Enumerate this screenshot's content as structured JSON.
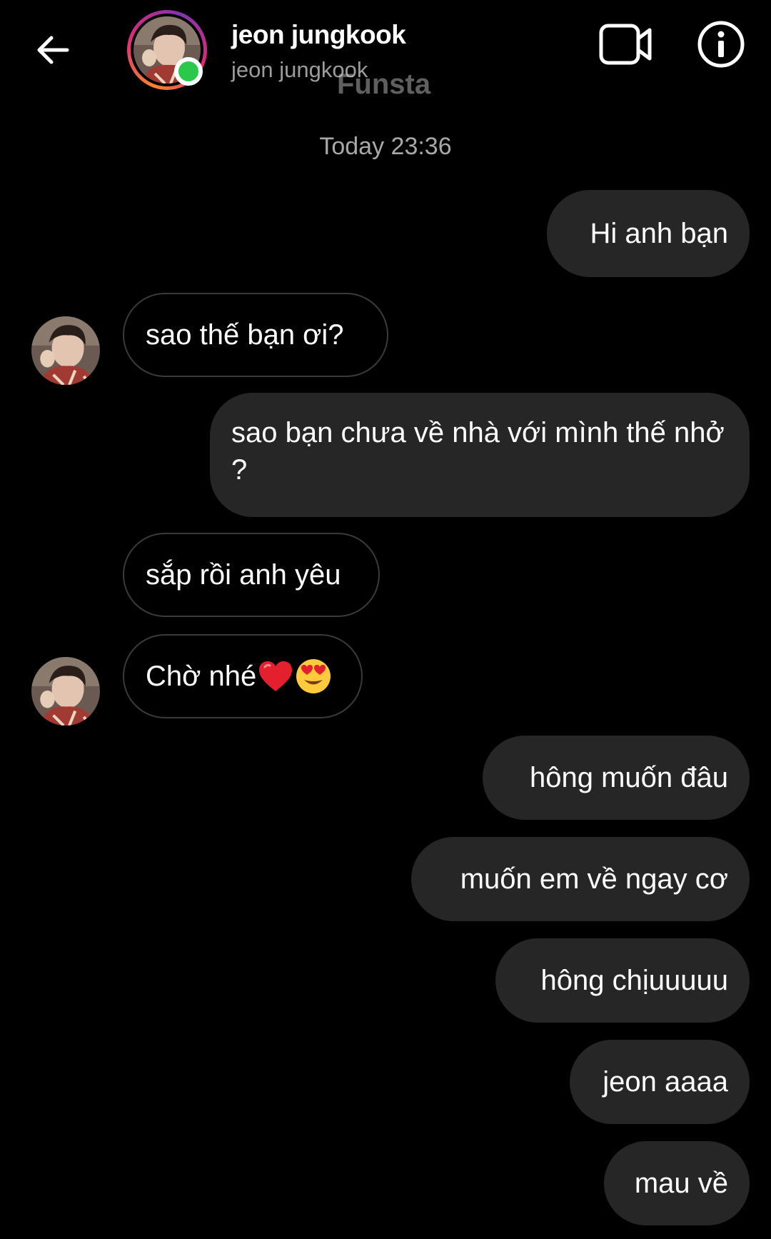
{
  "header": {
    "name": "jeon jungkook",
    "subtitle": "jeon jungkook",
    "watermark": "Funsta"
  },
  "timestamp": "Today 23:36",
  "messages": [
    {
      "from": "me",
      "text": "Hi anh bạn"
    },
    {
      "from": "them",
      "text": "sao thế bạn ơi?"
    },
    {
      "from": "me",
      "text": "sao bạn chưa về nhà với mình thế nhở ?"
    },
    {
      "from": "them",
      "text": "sắp rồi anh yêu"
    },
    {
      "from": "them",
      "text": "Chờ nhé",
      "emojis": [
        "red-heart",
        "heart-eyes-face"
      ]
    },
    {
      "from": "me",
      "text": "hông muốn đâu"
    },
    {
      "from": "me",
      "text": "muốn em về ngay cơ"
    },
    {
      "from": "me",
      "text": "hông chịuuuuu"
    },
    {
      "from": "me",
      "text": "jeon aaaa"
    },
    {
      "from": "me",
      "text": "mau về"
    }
  ],
  "icons": {
    "back": "arrow-left-icon",
    "video": "video-camera-icon",
    "info": "info-icon"
  },
  "colors": {
    "background": "#000000",
    "sent_bubble": "#262626",
    "received_border": "#3a3a3a",
    "online": "#2ac94b",
    "muted_text": "#9c9c9c"
  }
}
